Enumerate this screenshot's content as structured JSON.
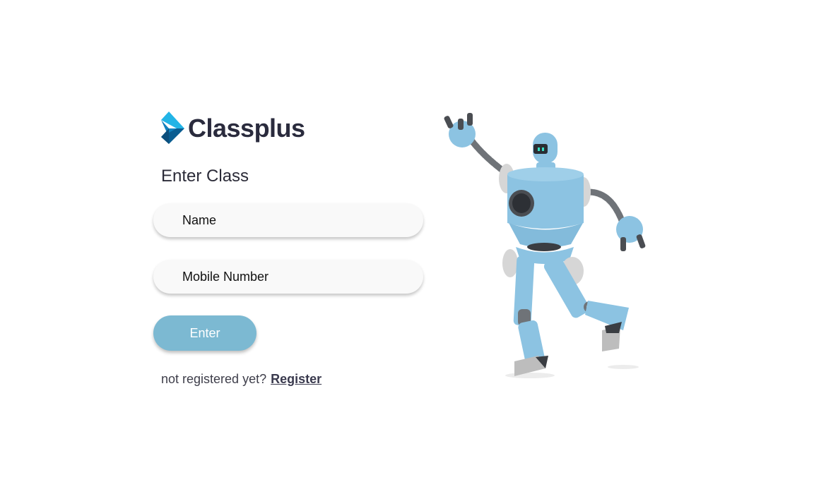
{
  "brand": {
    "name": "Classplus",
    "logo_icon": "classplus-diamond-logo",
    "colors": {
      "logo_light": "#22b4e6",
      "logo_dark": "#0a5d91",
      "text": "#2a2b3d"
    }
  },
  "form": {
    "heading": "Enter Class",
    "name_placeholder": "Name",
    "mobile_placeholder": "Mobile Number",
    "submit_label": "Enter",
    "submit_color": "#7cb9d2"
  },
  "register": {
    "prompt": "not registered yet?",
    "link_label": "Register"
  },
  "illustration": {
    "name": "robot-illustration",
    "colors": {
      "body": "#8cc3e2",
      "joint": "#d6d6d6",
      "arm": "#6f7378"
    }
  }
}
